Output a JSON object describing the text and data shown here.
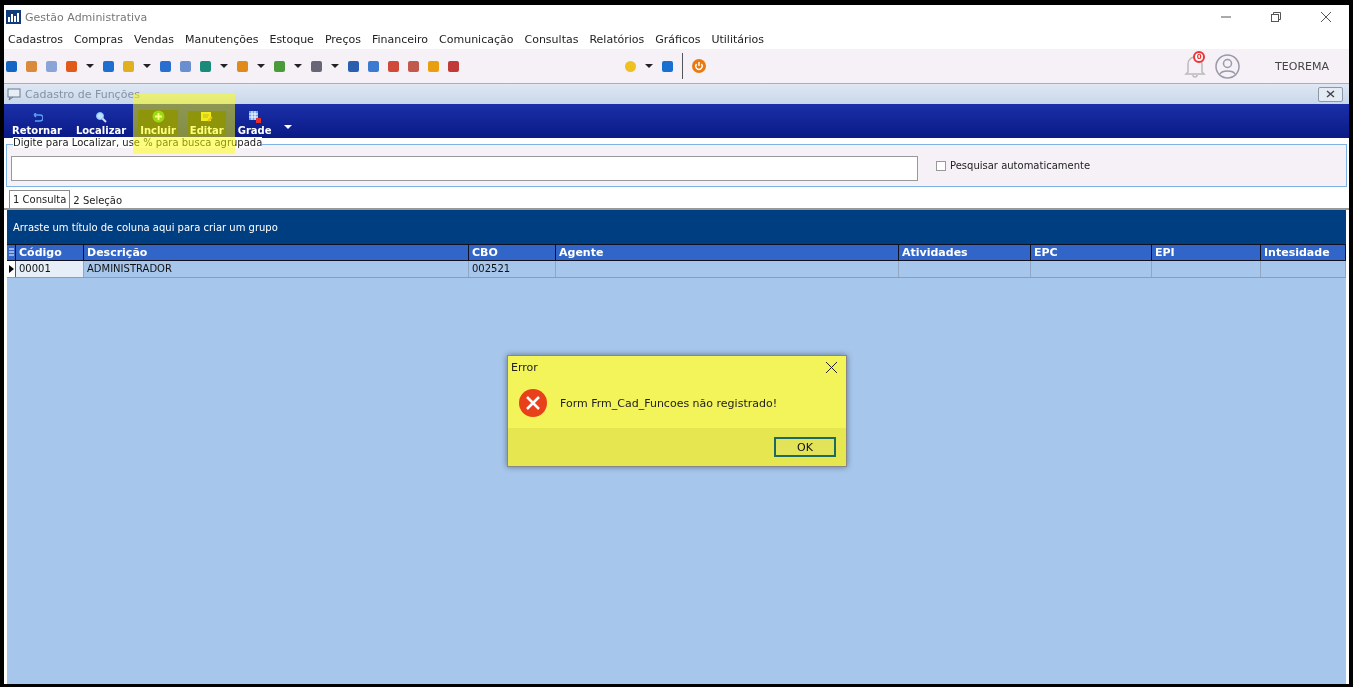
{
  "window": {
    "title": "Gestão Administrativa"
  },
  "menu": [
    "Cadastros",
    "Compras",
    "Vendas",
    "Manutenções",
    "Estoque",
    "Preços",
    "Financeiro",
    "Comunicação",
    "Consultas",
    "Relatórios",
    "Gráficos",
    "Utilitários"
  ],
  "header": {
    "notification_count": "0",
    "user": "TEOREMA"
  },
  "child_window": {
    "title": "Cadastro de Funções"
  },
  "toolbar": [
    {
      "label": "Retornar",
      "highlighted": false
    },
    {
      "label": "Localizar",
      "highlighted": false
    },
    {
      "label": "Incluir",
      "highlighted": true
    },
    {
      "label": "Editar",
      "highlighted": true
    },
    {
      "label": "Grade",
      "highlighted": false
    }
  ],
  "search": {
    "label": "Digite para Localizar, use % para busca agrupada",
    "auto_search": {
      "label": "Pesquisar automaticamente",
      "checked": false
    }
  },
  "tabs": [
    {
      "label": "1 Consulta",
      "selected": true
    },
    {
      "label": "2 Seleção",
      "selected": false
    }
  ],
  "group_panel": {
    "hint": "Arraste um título de coluna aqui para criar um grupo"
  },
  "table": {
    "columns": [
      "Código",
      "Descrição",
      "CBO",
      "Agente",
      "Atividades",
      "EPC",
      "EPI",
      "Intesidade"
    ],
    "rows": [
      {
        "current": true,
        "cells": [
          "00001",
          "ADMINISTRADOR",
          "002521",
          "",
          "",
          "",
          "",
          ""
        ]
      }
    ]
  },
  "dialog": {
    "title": "Error",
    "message": "Form Frm_Cad_Funcoes não registrado!",
    "button": "OK"
  }
}
